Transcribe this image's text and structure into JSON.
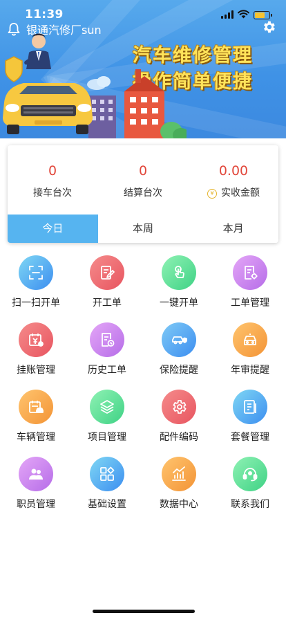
{
  "status_bar": {
    "time": "11:39",
    "battery_level": 0.7
  },
  "header": {
    "shop_name": "银通汽修厂sun",
    "bell_icon": "bell-icon",
    "settings_icon": "gear-icon"
  },
  "banner": {
    "slogan_line1": "汽车维修管理",
    "slogan_line2": "操作简单便捷"
  },
  "stats": {
    "items": [
      {
        "value": "0",
        "label": "接车台次"
      },
      {
        "value": "0",
        "label": "结算台次"
      },
      {
        "value": "0.00",
        "label": "实收金额",
        "icon": "coin-icon",
        "icon_glyph": "¥"
      }
    ],
    "tabs": [
      {
        "label": "今日",
        "active": true
      },
      {
        "label": "本周",
        "active": false
      },
      {
        "label": "本月",
        "active": false
      }
    ]
  },
  "menu": [
    {
      "label": "扫一扫开单",
      "icon": "scan-icon",
      "color_from": "#7fd7f4",
      "color_to": "#3c8ef0"
    },
    {
      "label": "开工单",
      "icon": "edit-doc-icon",
      "color_from": "#f58b8b",
      "color_to": "#e85560"
    },
    {
      "label": "一键开单",
      "icon": "tap-icon",
      "color_from": "#8ff2b4",
      "color_to": "#3fd285"
    },
    {
      "label": "工单管理",
      "icon": "doc-gear-icon",
      "color_from": "#e4a6f7",
      "color_to": "#b66de8"
    },
    {
      "label": "挂账管理",
      "icon": "calendar-yen-icon",
      "color_from": "#f58b8b",
      "color_to": "#e85560"
    },
    {
      "label": "历史工单",
      "icon": "doc-clock-icon",
      "color_from": "#e4a6f7",
      "color_to": "#b66de8"
    },
    {
      "label": "保险提醒",
      "icon": "car-shield-icon",
      "color_from": "#7fcaf6",
      "color_to": "#3c8ef0"
    },
    {
      "label": "年审提醒",
      "icon": "car-alert-icon",
      "color_from": "#ffc46e",
      "color_to": "#f39436"
    },
    {
      "label": "车辆管理",
      "icon": "calendar-car-icon",
      "color_from": "#ffc46e",
      "color_to": "#f39436"
    },
    {
      "label": "项目管理",
      "icon": "layers-icon",
      "color_from": "#8ff2b4",
      "color_to": "#3fd285"
    },
    {
      "label": "配件编码",
      "icon": "gear-part-icon",
      "color_from": "#f58b8b",
      "color_to": "#e85560"
    },
    {
      "label": "套餐管理",
      "icon": "package-icon",
      "color_from": "#7fd7f4",
      "color_to": "#3c8ef0"
    },
    {
      "label": "职员管理",
      "icon": "staff-icon",
      "color_from": "#e4a6f7",
      "color_to": "#b66de8"
    },
    {
      "label": "基础设置",
      "icon": "grid-settings-icon",
      "color_from": "#7fd7f4",
      "color_to": "#3c8ef0"
    },
    {
      "label": "数据中心",
      "icon": "chart-icon",
      "color_from": "#ffc46e",
      "color_to": "#f39436"
    },
    {
      "label": "联系我们",
      "icon": "headset-icon",
      "color_from": "#8ff2b4",
      "color_to": "#3fd285"
    }
  ]
}
